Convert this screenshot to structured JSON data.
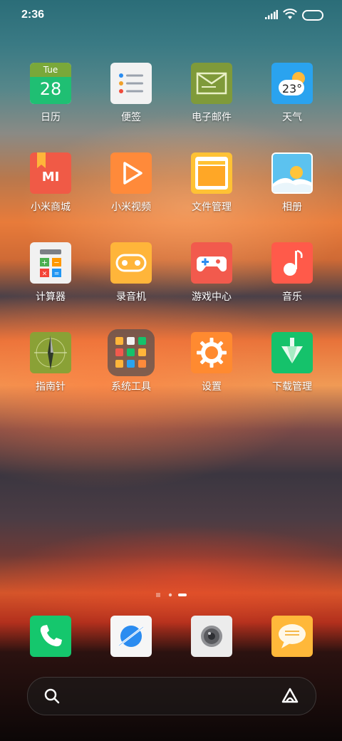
{
  "status_bar": {
    "time": "2:36"
  },
  "apps": [
    {
      "label": "日历",
      "icon": "calendar-icon"
    },
    {
      "label": "便签",
      "icon": "notes-icon"
    },
    {
      "label": "电子邮件",
      "icon": "email-icon"
    },
    {
      "label": "天气",
      "icon": "weather-icon"
    },
    {
      "label": "小米商城",
      "icon": "mi-store-icon"
    },
    {
      "label": "小米视频",
      "icon": "mi-video-icon"
    },
    {
      "label": "文件管理",
      "icon": "file-manager-icon"
    },
    {
      "label": "相册",
      "icon": "gallery-icon"
    },
    {
      "label": "计算器",
      "icon": "calculator-icon"
    },
    {
      "label": "录音机",
      "icon": "recorder-icon"
    },
    {
      "label": "游戏中心",
      "icon": "game-center-icon"
    },
    {
      "label": "音乐",
      "icon": "music-icon"
    },
    {
      "label": "指南针",
      "icon": "compass-icon"
    },
    {
      "label": "系统工具",
      "icon": "system-tools-folder-icon"
    },
    {
      "label": "设置",
      "icon": "settings-icon"
    },
    {
      "label": "下载管理",
      "icon": "download-manager-icon"
    }
  ],
  "calendar": {
    "weekday": "Tue",
    "day": "28"
  },
  "weather": {
    "temp": "23°"
  },
  "mi_store": {
    "logo_text": "MI"
  },
  "dock": [
    "phone-icon",
    "browser-icon",
    "camera-icon",
    "messages-icon"
  ],
  "colors": {
    "calendar_green": "#1fbf73",
    "email_olive": "#7f9a3a",
    "weather_blue": "#2aa3ef",
    "mi_red": "#f05a46",
    "video_orange": "#ff8a3a",
    "files_yellow": "#ffc235",
    "calc_white": "#f1f1f1",
    "recorder_yellow": "#ffb53a",
    "game_red": "#f25a4d",
    "music_red": "#ff5a4a",
    "compass_olive": "#8aa136",
    "settings_orange": "#ff8a30",
    "download_green": "#15c26b",
    "phone_green": "#15c76d",
    "message_yellow": "#ffb83a"
  }
}
